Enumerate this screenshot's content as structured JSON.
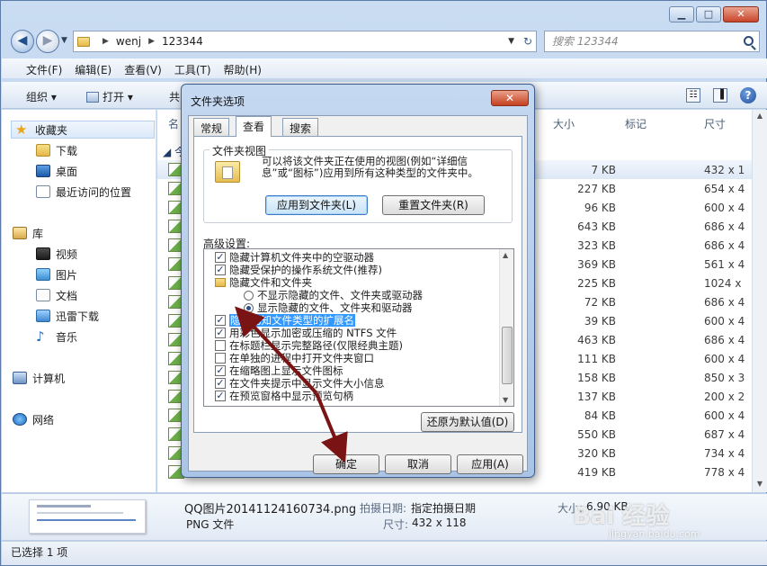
{
  "window": {
    "controls": [
      "▁",
      "□",
      "✕"
    ]
  },
  "address": {
    "crumbs": [
      "wenj",
      "123344"
    ],
    "search_placeholder": "搜索 123344"
  },
  "menubar": [
    "文件(F)",
    "编辑(E)",
    "查看(V)",
    "工具(T)",
    "帮助(H)"
  ],
  "cmdbar": {
    "organize": "组织 ▾",
    "open": "打开 ▾",
    "share": "共",
    "help": "?"
  },
  "nav": {
    "favorites": "收藏夹",
    "downloads": "下载",
    "desktop": "桌面",
    "recent": "最近访问的位置",
    "libraries": "库",
    "videos": "视频",
    "pictures": "图片",
    "documents": "文档",
    "xunlei": "迅雷下载",
    "music": "音乐",
    "computer": "计算机",
    "network": "网络"
  },
  "columns": {
    "name": "名",
    "size": "大小",
    "tag": "标记",
    "dimension": "尺寸",
    "group": "今"
  },
  "rows": [
    {
      "size": "7 KB",
      "dim": "432 x 1"
    },
    {
      "size": "227 KB",
      "dim": "654 x 4"
    },
    {
      "size": "96 KB",
      "dim": "600 x 4"
    },
    {
      "size": "643 KB",
      "dim": "686 x 4"
    },
    {
      "size": "323 KB",
      "dim": "686 x 4"
    },
    {
      "size": "369 KB",
      "dim": "561 x 4"
    },
    {
      "size": "225 KB",
      "dim": "1024 x"
    },
    {
      "size": "72 KB",
      "dim": "686 x 4"
    },
    {
      "size": "39 KB",
      "dim": "600 x 4"
    },
    {
      "size": "463 KB",
      "dim": "686 x 4"
    },
    {
      "size": "111 KB",
      "dim": "600 x 4"
    },
    {
      "size": "158 KB",
      "dim": "850 x 3"
    },
    {
      "size": "137 KB",
      "dim": "200 x 2"
    },
    {
      "size": "84 KB",
      "dim": "600 x 4"
    },
    {
      "size": "550 KB",
      "dim": "687 x 4"
    },
    {
      "size": "320 KB",
      "dim": "734 x 4"
    },
    {
      "size": "419 KB",
      "dim": "778 x 4"
    }
  ],
  "details": {
    "filename": "QQ图片20141124160734.png",
    "date_label": "拍摄日期:",
    "date_value": "指定拍摄日期",
    "type": "PNG 文件",
    "size_label": "大小:",
    "size_value": "6.90 KB",
    "dim_label": "尺寸:",
    "dim_value": "432 x 118"
  },
  "status": "已选择 1 项",
  "dialog": {
    "title": "文件夹选项",
    "close": "✕",
    "tabs": [
      "常规",
      "查看",
      "搜索"
    ],
    "group_title": "文件夹视图",
    "group_desc": "可以将该文件夹正在使用的视图(例如“详细信息”或“图标”)应用到所有这种类型的文件夹中。",
    "apply_to_folders": "应用到文件夹(L)",
    "reset_folders": "重置文件夹(R)",
    "advanced_label": "高级设置:",
    "options": [
      {
        "text": "隐藏计算机文件夹中的空驱动器",
        "type": "cb",
        "checked": true
      },
      {
        "text": "隐藏受保护的操作系统文件(推荐)",
        "type": "cb",
        "checked": true
      },
      {
        "text": "隐藏文件和文件夹",
        "type": "folder"
      },
      {
        "text": "不显示隐藏的文件、文件夹或驱动器",
        "type": "rb",
        "checked": false
      },
      {
        "text": "显示隐藏的文件、文件夹和驱动器",
        "type": "rb",
        "checked": true
      },
      {
        "text": "隐藏已知文件类型的扩展名",
        "type": "cb",
        "checked": true,
        "highlight": true
      },
      {
        "text": "用彩色显示加密或压缩的 NTFS 文件",
        "type": "cb",
        "checked": true
      },
      {
        "text": "在标题栏显示完整路径(仅限经典主题)",
        "type": "cb",
        "checked": false
      },
      {
        "text": "在单独的进程中打开文件夹窗口",
        "type": "cb",
        "checked": false
      },
      {
        "text": "在缩略图上显示文件图标",
        "type": "cb",
        "checked": true
      },
      {
        "text": "在文件夹提示中显示文件大小信息",
        "type": "cb",
        "checked": true
      },
      {
        "text": "在预览窗格中显示预览句柄",
        "type": "cb",
        "checked": true
      }
    ],
    "restore_defaults": "还原为默认值(D)",
    "ok": "确定",
    "cancel": "取消",
    "apply": "应用(A)"
  },
  "watermark": {
    "main": "Bai 经验",
    "sub": "jingyan.baidu.com"
  },
  "colors": {
    "annotation": "#7a1414",
    "selection": "#3399ff"
  }
}
